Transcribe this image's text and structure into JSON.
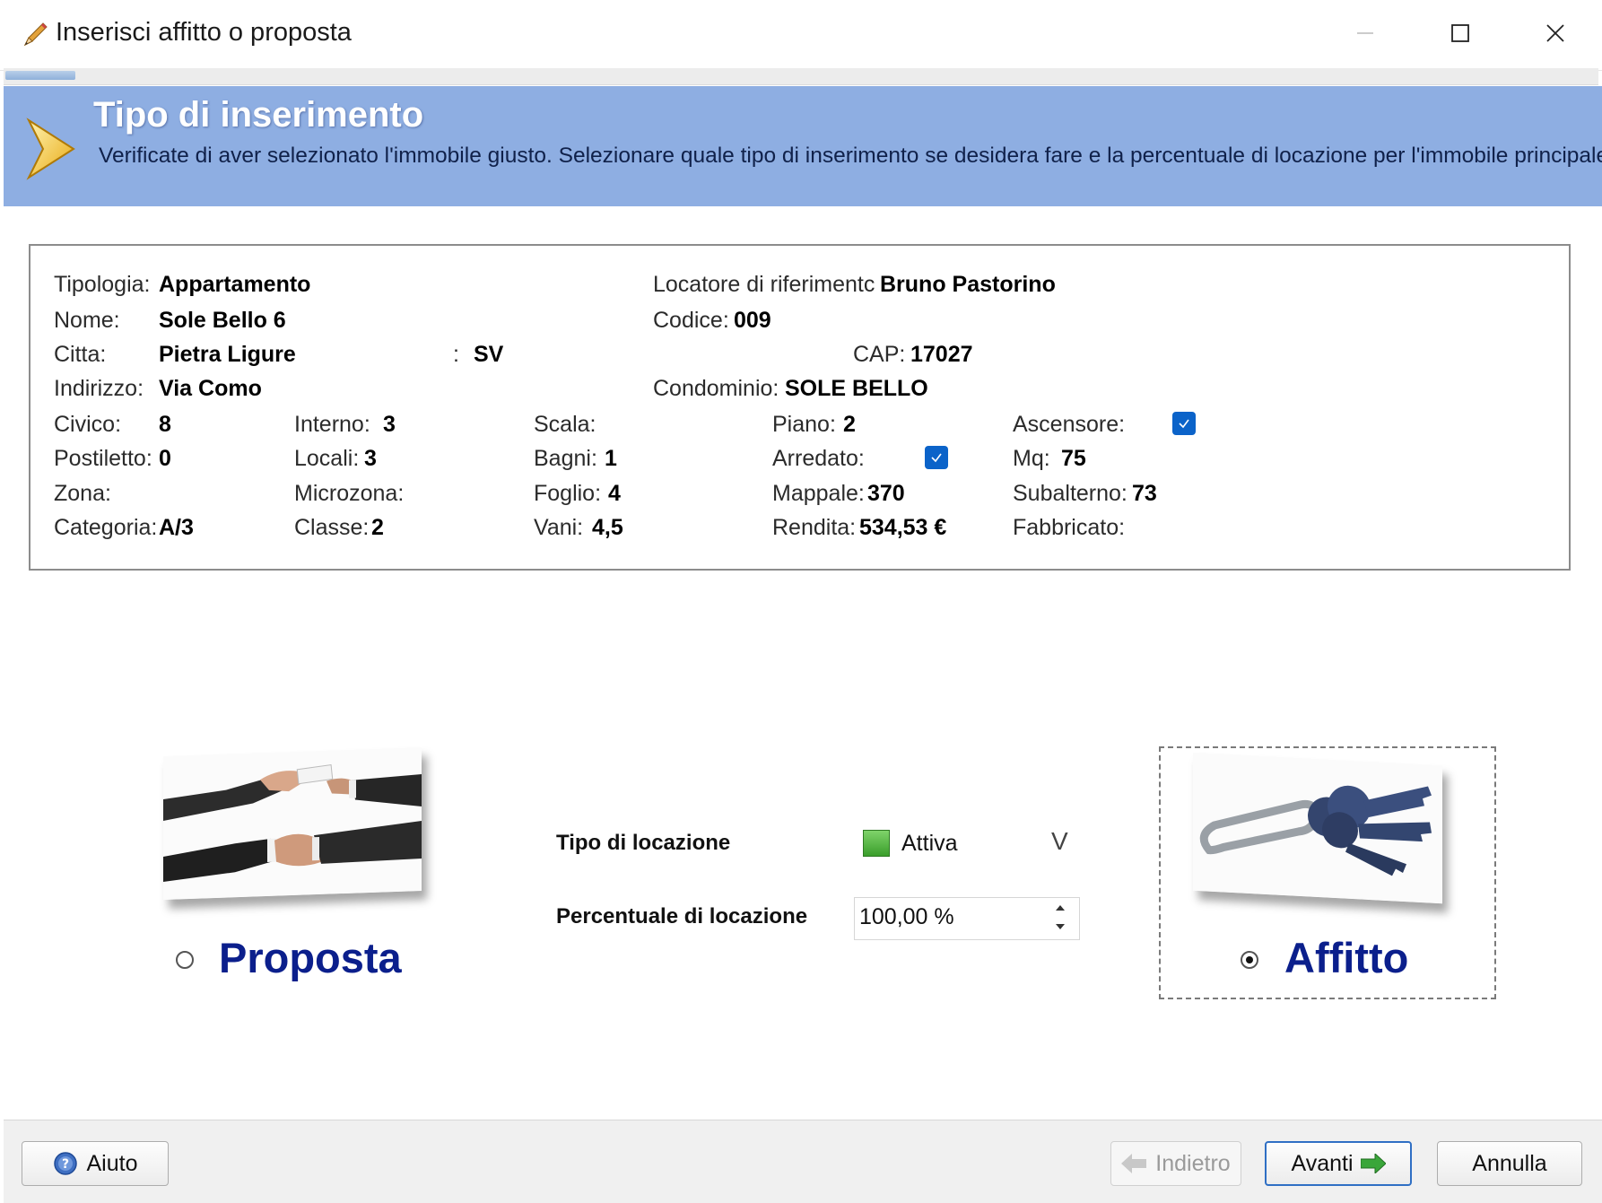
{
  "window": {
    "title": "Inserisci affitto o proposta"
  },
  "header": {
    "title": "Tipo di inserimento",
    "description": "Verificate di aver selezionato l'immobile giusto. Selezionare quale tipo di inserimento se desidera fare e la percentuale di locazione per l'immobile principale."
  },
  "property": {
    "tipologia_label": "Tipologia:",
    "tipologia": "Appartamento",
    "locatore_label": "Locatore di riferimentc",
    "locatore": "Bruno Pastorino",
    "nome_label": "Nome:",
    "nome": "Sole Bello 6",
    "codice_label": "Codice:",
    "codice": "009",
    "citta_label": "Citta:",
    "citta": "Pietra Ligure",
    "provincia_label": ":",
    "provincia": "SV",
    "cap_label": "CAP:",
    "cap": "17027",
    "indirizzo_label": "Indirizzo:",
    "indirizzo": "Via Como",
    "condominio_label": "Condominio:",
    "condominio": "SOLE BELLO",
    "civico_label": "Civico:",
    "civico": "8",
    "interno_label": "Interno:",
    "interno": "3",
    "scala_label": "Scala:",
    "scala": "",
    "piano_label": "Piano:",
    "piano": "2",
    "ascensore_label": "Ascensore:",
    "ascensore": true,
    "postiletto_label": "Postiletto:",
    "postiletto": "0",
    "locali_label": "Locali:",
    "locali": "3",
    "bagni_label": "Bagni:",
    "bagni": "1",
    "arredato_label": "Arredato:",
    "arredato": true,
    "mq_label": "Mq:",
    "mq": "75",
    "zona_label": "Zona:",
    "zona": "",
    "microzona_label": "Microzona:",
    "microzona": "",
    "foglio_label": "Foglio:",
    "foglio": "4",
    "mappale_label": "Mappale:",
    "mappale": "370",
    "subalterno_label": "Subalterno:",
    "subalterno": "73",
    "categoria_label": "Categoria:",
    "categoria": "A/3",
    "classe_label": "Classe:",
    "classe": "2",
    "vani_label": "Vani:",
    "vani": "4,5",
    "rendita_label": "Rendita:",
    "rendita": "534,53 €",
    "fabbricato_label": "Fabbricato:",
    "fabbricato": ""
  },
  "options": {
    "proposta_label": "Proposta",
    "affitto_label": "Affitto",
    "selected": "Affitto"
  },
  "locazione": {
    "tipo_label": "Tipo di locazione",
    "tipo_value": "Attiva",
    "dropdown_glyph": "V",
    "percentuale_label": "Percentuale di locazione",
    "percentuale_value": "100,00 %"
  },
  "footer": {
    "aiuto": "Aiuto",
    "indietro": "Indietro",
    "avanti": "Avanti",
    "annulla": "Annulla"
  },
  "colors": {
    "banner": "#8eaee2",
    "option_text": "#0b1f8c",
    "checkbox": "#0b63c9",
    "avanti_border": "#2f6fc4"
  }
}
